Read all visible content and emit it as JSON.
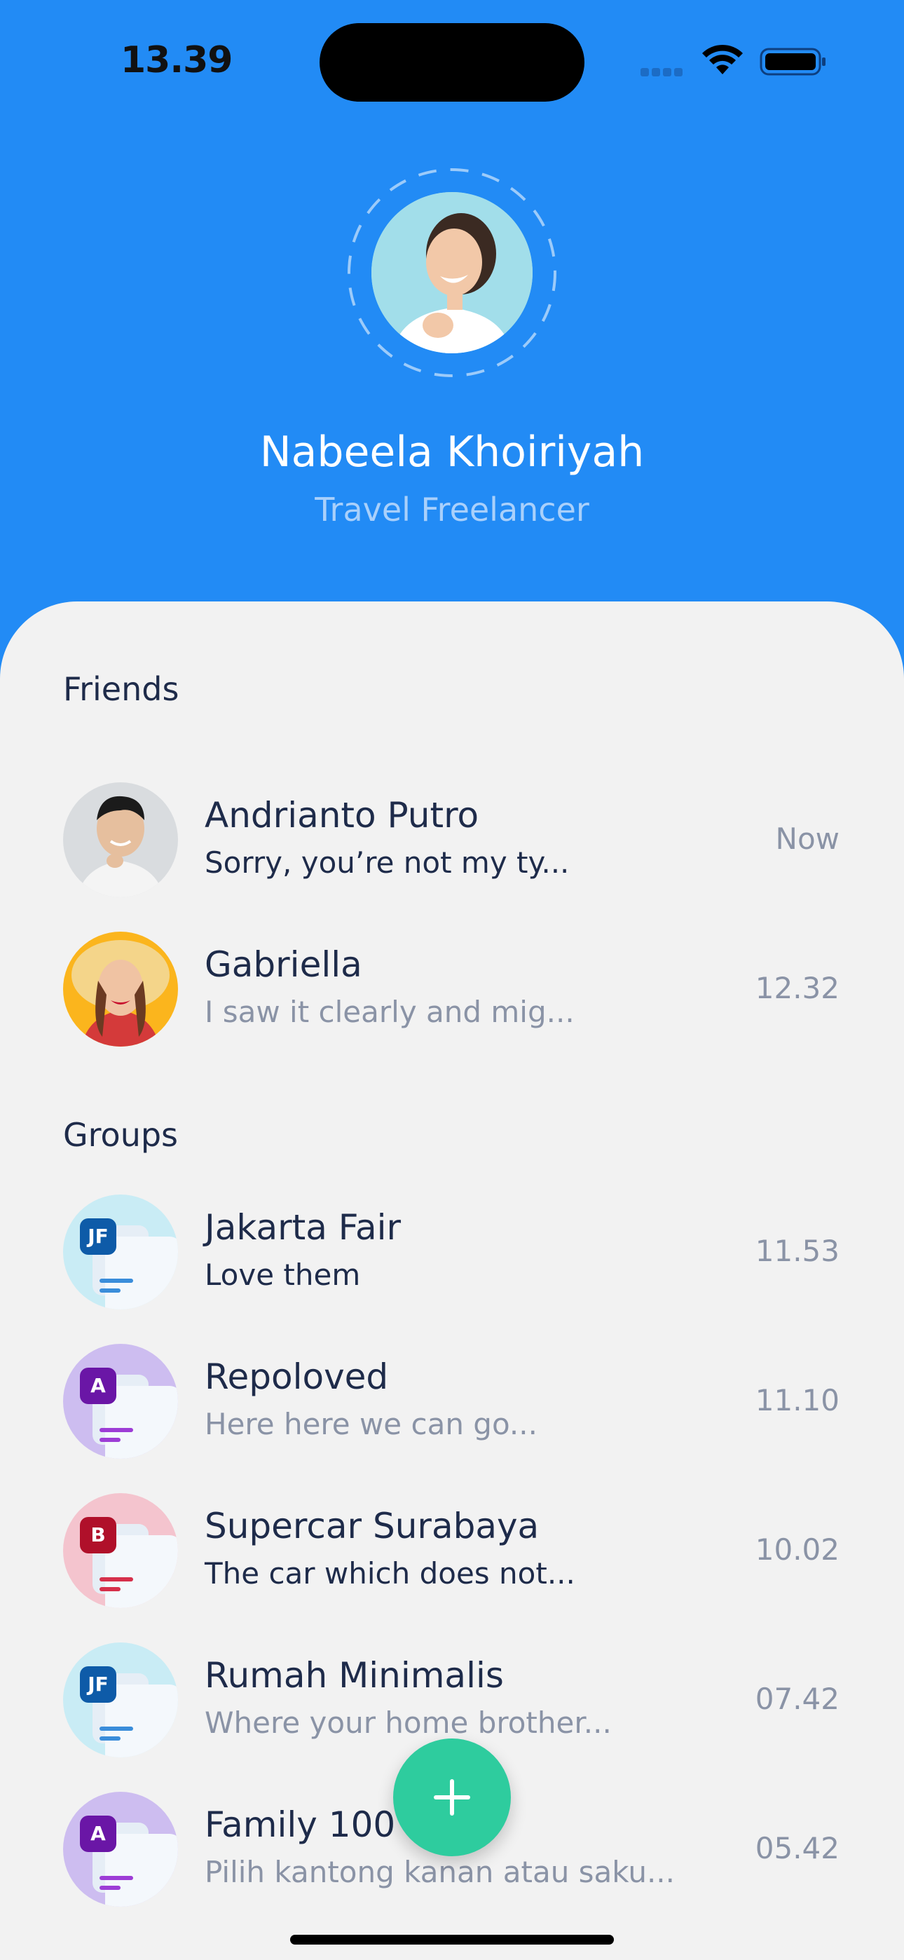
{
  "status": {
    "time": "13.39"
  },
  "profile": {
    "name": "Nabeela Khoiriyah",
    "title": "Travel Freelancer"
  },
  "friends": {
    "section_title": "Friends",
    "items": [
      {
        "name": "Andrianto Putro",
        "message": "Sorry, you’re not my ty...",
        "time": "Now"
      },
      {
        "name": "Gabriella",
        "message": "I saw it clearly and mig...",
        "time": "12.32"
      }
    ]
  },
  "groups": {
    "section_title": "Groups",
    "items": [
      {
        "name": "Jakarta Fair",
        "message": "Love them",
        "time": "11.53",
        "badge": "JF",
        "bg": "#C9ECF5",
        "badge_color": "#0E5BA8",
        "line_color": "#3A8DDA"
      },
      {
        "name": "Repoloved",
        "message": "Here here we can go...",
        "time": "11.10",
        "badge": "A",
        "bg": "#CDBDF0",
        "badge_color": "#6A16A6",
        "line_color": "#9D3DD6"
      },
      {
        "name": "Supercar Surabaya",
        "message": "The car which does not...",
        "time": "10.02",
        "badge": "B",
        "bg": "#F4C4CE",
        "badge_color": "#B0102A",
        "line_color": "#D6304B"
      },
      {
        "name": "Rumah Minimalis",
        "message": "Where your home brother...",
        "time": "07.42",
        "badge": "JF",
        "bg": "#C9ECF5",
        "badge_color": "#0E5BA8",
        "line_color": "#3A8DDA"
      },
      {
        "name": "Family 100",
        "message": "Pilih kantong kanan atau saku...",
        "time": "05.42",
        "badge": "A",
        "bg": "#CDBDF0",
        "badge_color": "#6A16A6",
        "line_color": "#9D3DD6"
      }
    ]
  },
  "fab": {
    "icon": "plus-icon"
  }
}
